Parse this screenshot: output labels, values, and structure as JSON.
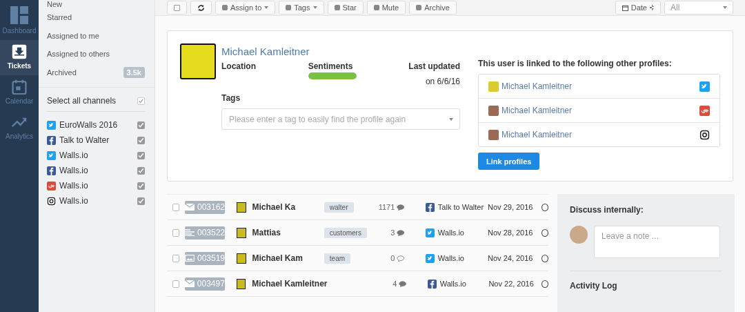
{
  "nav": [
    {
      "label": "Dashboard",
      "kind": "dashboard",
      "selected": false
    },
    {
      "label": "Tickets",
      "kind": "tickets",
      "selected": true
    },
    {
      "label": "Calendar",
      "kind": "calendar",
      "selected": false
    },
    {
      "label": "Analytics",
      "kind": "analytics",
      "selected": false
    }
  ],
  "views": [
    {
      "label": "New"
    },
    {
      "label": "Starred"
    },
    {
      "label": "Assigned to me"
    },
    {
      "label": "Assigned to others"
    },
    {
      "label": "Archived",
      "badge": "3.5k"
    }
  ],
  "select_all": {
    "label": "Select all channels",
    "checked": true
  },
  "channels": [
    {
      "label": "EuroWalls 2016",
      "kind": "twitter",
      "checked": true
    },
    {
      "label": "Talk to Walter",
      "kind": "facebook",
      "checked": true
    },
    {
      "label": "Walls.io",
      "kind": "twitter",
      "checked": true
    },
    {
      "label": "Walls.io",
      "kind": "facebook",
      "checked": true
    },
    {
      "label": "Walls.io",
      "kind": "gplus",
      "checked": true
    },
    {
      "label": "Walls.io",
      "kind": "instagram",
      "checked": true
    }
  ],
  "toolbar": {
    "actions": [
      {
        "kind": "checkbox",
        "checked": false
      },
      {
        "kind": "refresh"
      },
      {
        "kind": "assign",
        "label": "Assign to",
        "caret": true
      },
      {
        "kind": "tags",
        "label": "Tags",
        "caret": true
      },
      {
        "kind": "star",
        "label": "Star",
        "caret": false
      },
      {
        "kind": "mute",
        "label": "Mute",
        "caret": false
      },
      {
        "kind": "archive",
        "label": "Archive",
        "caret": false
      }
    ],
    "sort": {
      "label": "Date"
    },
    "filter": {
      "value": "All"
    }
  },
  "profile": {
    "name": "Michael Kamleitner",
    "location_label": "Location",
    "sentiment_label": "Sentiments",
    "sentiment": {
      "level": 1
    },
    "updated_label": "Last updated",
    "updated": "on 6/6/16",
    "tags_label": "Tags",
    "tags_placeholder": "Please enter a tag to easily find the profile again",
    "linked_heading": "This user is linked to the following other profiles:",
    "linked": [
      {
        "name": "Michael Kamleitner",
        "kind": "twitter"
      },
      {
        "name": "Michael Kamleitner",
        "kind": "gplus"
      },
      {
        "name": "Michael Kamleitner",
        "kind": "instagram"
      }
    ],
    "link_button": "Link profiles"
  },
  "tickets": [
    {
      "checked": false,
      "kind": "mail",
      "id": "003162",
      "name": "Michael Ka",
      "tag": "walter",
      "count": "1171",
      "comments_filled": true,
      "channel": {
        "kind": "facebook",
        "label": "Talk to Walter"
      },
      "date": "Nov 29, 2016"
    },
    {
      "checked": false,
      "kind": "text",
      "id": "003522",
      "name": "Mattias",
      "tag": "customers",
      "count": "3",
      "comments_filled": true,
      "channel": {
        "kind": "twitter",
        "label": "Walls.io"
      },
      "date": "Nov 28, 2016"
    },
    {
      "checked": false,
      "kind": "image",
      "id": "003519",
      "name": "Michael Kam",
      "tag": "team",
      "count": "0",
      "comments_filled": false,
      "channel": {
        "kind": "twitter",
        "label": "Walls.io"
      },
      "date": "Nov 24, 2016"
    },
    {
      "checked": false,
      "kind": "mail",
      "id": "003497",
      "name": "Michael Kamleitner",
      "count": "4",
      "comments_filled": true,
      "channel": {
        "kind": "facebook",
        "label": "Walls.io"
      },
      "date": "Nov 22, 2016"
    }
  ],
  "discussion": {
    "heading": "Discuss internally:",
    "placeholder": "Leave a note ...",
    "log_heading": "Activity Log"
  }
}
